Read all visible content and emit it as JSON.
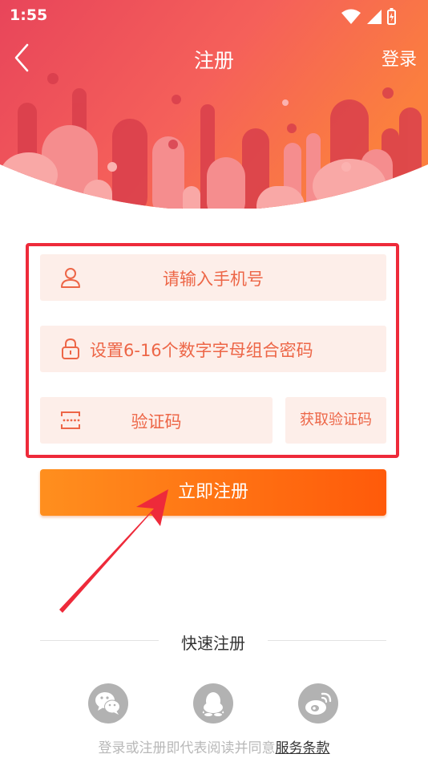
{
  "status_bar": {
    "time": "1:55"
  },
  "nav": {
    "title": "注册",
    "login_label": "登录"
  },
  "form": {
    "phone_placeholder": "请输入手机号",
    "password_placeholder": "设置6-16个数字字母组合密码",
    "code_placeholder": "验证码",
    "get_code_label": "获取验证码"
  },
  "submit_label": "立即注册",
  "quick_register": {
    "label": "快速注册",
    "providers": [
      "wechat-icon",
      "qq-icon",
      "weibo-icon"
    ]
  },
  "agreement": {
    "prefix": "登录或注册即代表阅读并同意",
    "terms_label": "服务条款"
  },
  "colors": {
    "accent": "#ed6647",
    "highlight_border": "#ee2a3a",
    "button_start": "#ff8f1e",
    "button_end": "#ff5a0a",
    "field_bg": "#fdeee9"
  }
}
